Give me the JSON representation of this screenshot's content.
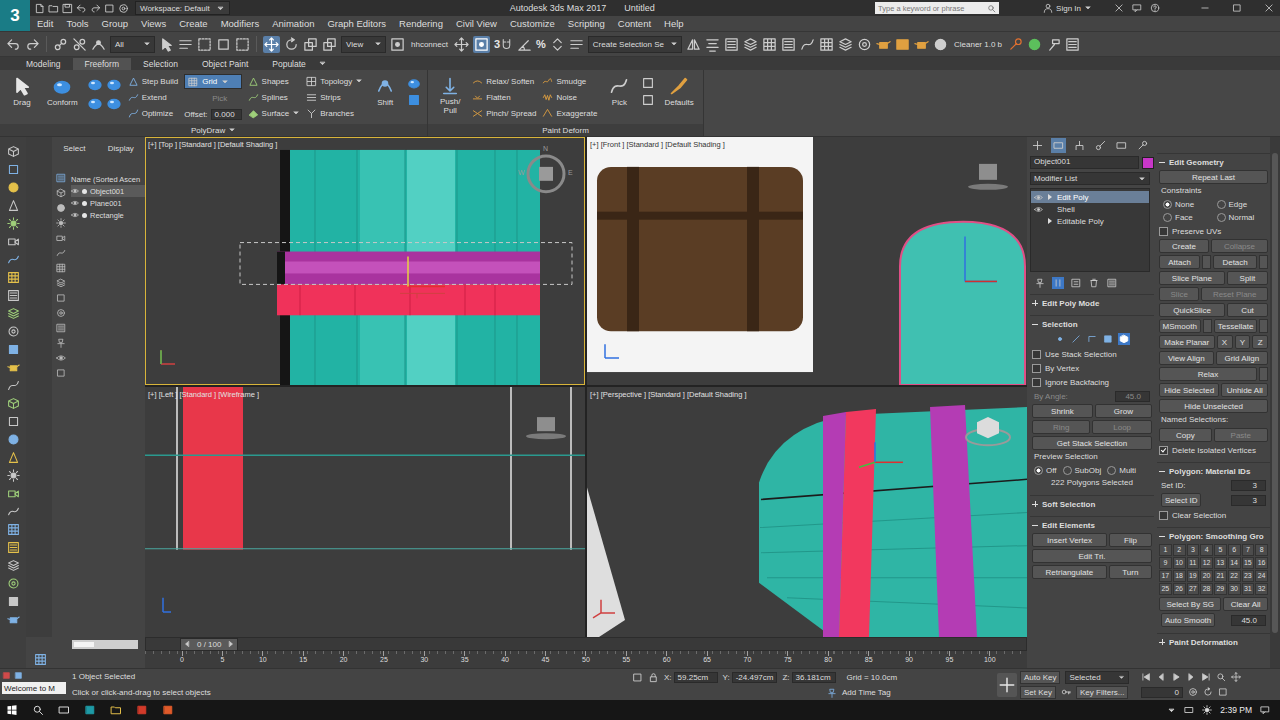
{
  "window": {
    "logo": "3",
    "workspace": "Workspace: Default",
    "title": "Autodesk 3ds Max 2017",
    "document": "Untitled",
    "search_placeholder": "Type a keyword or phrase",
    "sign_in": "Sign In"
  },
  "menu": [
    "Edit",
    "Tools",
    "Group",
    "Views",
    "Create",
    "Modifiers",
    "Animation",
    "Graph Editors",
    "Rendering",
    "Civil View",
    "Customize",
    "Scripting",
    "Content",
    "Help"
  ],
  "toolbar": {
    "selection_filter": "All",
    "reference_coord": "View",
    "plugin": "hhconnect",
    "snap_labels": [
      "3",
      "%"
    ],
    "named_selection": "Create Selection Se",
    "cleaner": "Cleaner 1.0 b"
  },
  "ribbon": {
    "tabs": [
      {
        "label": "Modeling",
        "selected": false
      },
      {
        "label": "Freeform",
        "selected": true
      },
      {
        "label": "Selection",
        "selected": false
      },
      {
        "label": "Object Paint",
        "selected": false
      },
      {
        "label": "Populate",
        "selected": false
      }
    ],
    "polydraw": {
      "large": [
        "Drag",
        "Conform"
      ],
      "step_tools": [
        "Step Build",
        "Extend",
        "Optimize"
      ],
      "grid": {
        "value": "Grid",
        "selected": true
      },
      "pick": {
        "label": "Pick",
        "disabled": true
      },
      "offset": {
        "label": "Offset:",
        "value": "0.000"
      },
      "draw_tools": [
        {
          "label": "Shapes",
          "dropdown": false
        },
        {
          "label": "Splines",
          "dropdown": false
        },
        {
          "label": "Surface",
          "dropdown": true
        }
      ],
      "topology_tools": [
        {
          "label": "Topology",
          "dropdown": true
        },
        {
          "label": "Strips",
          "dropdown": false
        },
        {
          "label": "Branches",
          "dropdown": false
        }
      ],
      "shift": "Shift",
      "footer": "PolyDraw"
    },
    "paint_deform": {
      "push_pull": "Push/\nPull",
      "tools_a": [
        "Relax/ Soften",
        "Flatten",
        "Pinch/ Spread"
      ],
      "tools_b": [
        "Smudge",
        "Noise",
        "Exaggerate"
      ],
      "pick": "Pick",
      "defaults": "Defaults",
      "footer": "Paint Deform"
    }
  },
  "scene_explorer": {
    "tabs": [
      "Select",
      "Display"
    ],
    "header": "Name (Sorted Ascen",
    "items": [
      {
        "name": "Object001",
        "selected": true
      },
      {
        "name": "Plane001",
        "selected": false
      },
      {
        "name": "Rectangle",
        "selected": false
      }
    ]
  },
  "viewports": [
    {
      "kind": "top",
      "label": "[+] [Top ] [Standard ] [Default Shading ]",
      "active": true,
      "compass": [
        "N",
        "W",
        "E"
      ]
    },
    {
      "kind": "front",
      "label": "[+] [Front ] [Standard ] [Default Shading ]",
      "active": false,
      "compass": []
    },
    {
      "kind": "left",
      "label": "[+] [Left ] [Standard ] [Wireframe ]",
      "active": false,
      "compass": []
    },
    {
      "kind": "perspective",
      "label": "[+] [Perspective ] [Standard ] [Default Shading ]",
      "active": false,
      "compass": []
    }
  ],
  "command_panel": {
    "tabs": [
      {
        "selected": false
      },
      {
        "selected": true
      },
      {
        "selected": false
      },
      {
        "selected": false
      },
      {
        "selected": false
      },
      {
        "selected": false
      }
    ],
    "object_name": "Object001",
    "object_color": "#c837c8",
    "modifier_list": "Modifier List",
    "stack": [
      {
        "name": "Edit Poly",
        "selected": true,
        "visible": true,
        "expandable": true
      },
      {
        "name": "Shell",
        "selected": false,
        "visible": true,
        "expandable": false
      },
      {
        "name": "Editable Poly",
        "selected": false,
        "visible": false,
        "expandable": true
      }
    ],
    "stack_tools": [
      {
        "on": false
      },
      {
        "on": true
      },
      {
        "on": false
      },
      {
        "on": false
      },
      {
        "on": false
      }
    ],
    "edit_poly_mode": {
      "title": "Edit Poly Mode",
      "expanded": false
    },
    "selection": {
      "title": "Selection",
      "expanded": true,
      "levels": [
        {
          "selected": false
        },
        {
          "selected": false
        },
        {
          "selected": false
        },
        {
          "selected": false
        },
        {
          "selected": true
        }
      ],
      "checks": [
        {
          "label": "Use Stack Selection",
          "checked": false
        },
        {
          "label": "By Vertex",
          "checked": false
        },
        {
          "label": "Ignore Backfacing",
          "checked": false
        }
      ],
      "by_angle": {
        "label": "By Angle:",
        "value": "45.0",
        "disabled": true
      },
      "buttons": [
        {
          "label": "Shrink",
          "disabled": false
        },
        {
          "label": "Grow",
          "disabled": false
        },
        {
          "label": "Ring",
          "disabled": true
        },
        {
          "label": "Loop",
          "disabled": true
        }
      ],
      "get_stack": "Get Stack Selection",
      "preview": {
        "label": "Preview Selection",
        "options": [
          {
            "label": "Off",
            "selected": true
          },
          {
            "label": "SubObj",
            "selected": false
          },
          {
            "label": "Multi",
            "selected": false
          }
        ]
      },
      "count": "222 Polygons Selected"
    },
    "soft_selection": {
      "title": "Soft Selection",
      "expanded": false
    },
    "edit_elements": {
      "title": "Edit Elements",
      "expanded": true,
      "rows": [
        [
          "Insert Vertex",
          "Flip"
        ],
        [
          "Edit Tri."
        ],
        [
          "Retriangulate",
          "Turn"
        ]
      ]
    },
    "edit_geometry": {
      "title": "Edit Geometry",
      "expanded": true,
      "repeat_last": "Repeat Last",
      "constraints": {
        "label": "Constraints",
        "options": [
          {
            "label": "None",
            "selected": true
          },
          {
            "label": "Edge",
            "selected": false
          },
          {
            "label": "Face",
            "selected": false
          },
          {
            "label": "Normal",
            "selected": false
          }
        ]
      },
      "preserve_uvs": {
        "label": "Preserve UVs",
        "checked": false
      },
      "rows": [
        [
          {
            "label": "Create",
            "disabled": false,
            "settings": false
          },
          {
            "label": "Collapse",
            "disabled": true,
            "settings": false
          }
        ],
        [
          {
            "label": "Attach",
            "disabled": false,
            "settings": true
          },
          {
            "label": "Detach",
            "disabled": false,
            "settings": true
          }
        ],
        [
          {
            "label": "Slice Plane",
            "disabled": false,
            "settings": false
          },
          {
            "label": "Split",
            "disabled": false,
            "settings": false
          }
        ],
        [
          {
            "label": "Slice",
            "disabled": true,
            "settings": false
          },
          {
            "label": "Reset Plane",
            "disabled": true,
            "settings": false
          }
        ],
        [
          {
            "label": "QuickSlice",
            "disabled": false,
            "settings": false
          },
          {
            "label": "Cut",
            "disabled": false,
            "settings": false
          }
        ],
        [
          {
            "label": "MSmooth",
            "disabled": false,
            "settings": true
          },
          {
            "label": "Tessellate",
            "disabled": false,
            "settings": true
          }
        ],
        [
          {
            "label": "Make Planar",
            "disabled": false,
            "settings": false
          },
          {
            "label": "X",
            "disabled": false,
            "settings": false
          },
          {
            "label": "Y",
            "disabled": false,
            "settings": false
          },
          {
            "label": "Z",
            "disabled": false,
            "settings": false
          }
        ],
        [
          {
            "label": "View Align",
            "disabled": false,
            "settings": false
          },
          {
            "label": "Grid Align",
            "disabled": false,
            "settings": false
          }
        ],
        [
          {
            "label": "Relax",
            "disabled": false,
            "settings": true
          }
        ],
        [
          {
            "label": "Hide Selected",
            "disabled": false,
            "settings": false
          },
          {
            "label": "Unhide All",
            "disabled": false,
            "settings": false
          }
        ],
        [
          {
            "label": "Hide Unselected",
            "disabled": false,
            "settings": false
          }
        ]
      ],
      "named": {
        "label": "Named Selections:",
        "buttons": [
          {
            "label": "Copy",
            "disabled": false
          },
          {
            "label": "Paste",
            "disabled": true
          }
        ]
      },
      "delete_isolated": {
        "label": "Delete Isolated Vertices",
        "checked": true
      }
    },
    "material_ids": {
      "title": "Polygon: Material IDs",
      "expanded": true,
      "set_id": {
        "label": "Set ID:",
        "value": "3"
      },
      "select_id": {
        "label": "Select ID",
        "value": "3"
      },
      "clear_selection": {
        "label": "Clear Selection",
        "checked": false
      }
    },
    "smoothing": {
      "title": "Polygon: Smoothing Gro",
      "expanded": true,
      "groups": [
        "1",
        "2",
        "3",
        "4",
        "5",
        "6",
        "7",
        "8",
        "9",
        "10",
        "11",
        "12",
        "13",
        "14",
        "15",
        "16",
        "17",
        "18",
        "19",
        "20",
        "21",
        "22",
        "23",
        "24",
        "25",
        "26",
        "27",
        "28",
        "29",
        "30",
        "31",
        "32"
      ],
      "select_by_sg": "Select By SG",
      "clear_all": "Clear All",
      "auto_smooth": {
        "label": "Auto Smooth",
        "value": "45.0"
      }
    },
    "paint_deformation": {
      "title": "Paint Deformation",
      "expanded": false
    }
  },
  "timeline": {
    "slider": "0 / 100",
    "ticks": [
      "0",
      "5",
      "10",
      "15",
      "20",
      "25",
      "30",
      "35",
      "40",
      "45",
      "50",
      "55",
      "60",
      "65",
      "70",
      "75",
      "80",
      "85",
      "90",
      "95",
      "100"
    ]
  },
  "status": {
    "listener": "Welcome to M",
    "selected": "1 Object Selected",
    "prompt": "Click or click-and-drag to select objects",
    "coords": [
      {
        "axis": "X:",
        "value": "59.25cm"
      },
      {
        "axis": "Y:",
        "value": "-24.497cm"
      },
      {
        "axis": "Z:",
        "value": "36.181cm"
      }
    ],
    "grid": "Grid = 10.0cm",
    "time_tag": "Add Time Tag",
    "auto_key": "Auto Key",
    "key_mode": "Selected",
    "set_key": "Set Key",
    "key_filters": "Key Filters...",
    "frame": "0"
  },
  "taskbar": {
    "time": "2:39 PM"
  }
}
